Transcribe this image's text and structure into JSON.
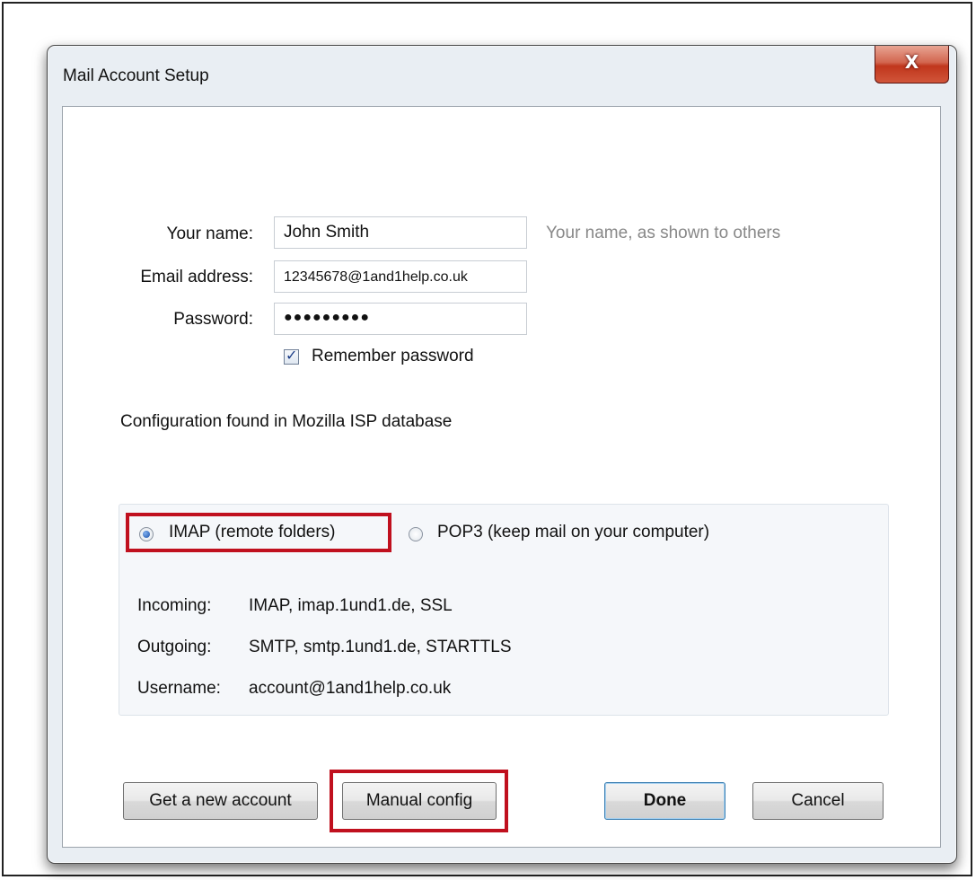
{
  "window": {
    "title": "Mail Account Setup",
    "close_glyph": "X"
  },
  "form": {
    "name_label": "Your name:",
    "name_value": "John Smith",
    "name_hint": "Your name, as shown to others",
    "email_label": "Email address:",
    "email_value": "12345678@1and1help.co.uk",
    "password_label": "Password:",
    "password_value": "●●●●●●●●●",
    "remember_label": "Remember password",
    "remember_checked": true
  },
  "status": "Configuration found in Mozilla ISP database",
  "protocol": {
    "imap_label": "IMAP (remote folders)",
    "pop3_label": "POP3 (keep mail on your computer)",
    "selected": "imap"
  },
  "server": {
    "incoming_label": "Incoming:",
    "incoming_value": "IMAP, imap.1und1.de, SSL",
    "outgoing_label": "Outgoing:",
    "outgoing_value": "SMTP, smtp.1und1.de, STARTTLS",
    "username_label": "Username:",
    "username_value": "account@1and1help.co.uk"
  },
  "buttons": {
    "new_account": "Get a new account",
    "manual_config": "Manual config",
    "done": "Done",
    "cancel": "Cancel"
  },
  "colors": {
    "highlight": "#c0101e",
    "close_button": "#c0361c"
  }
}
